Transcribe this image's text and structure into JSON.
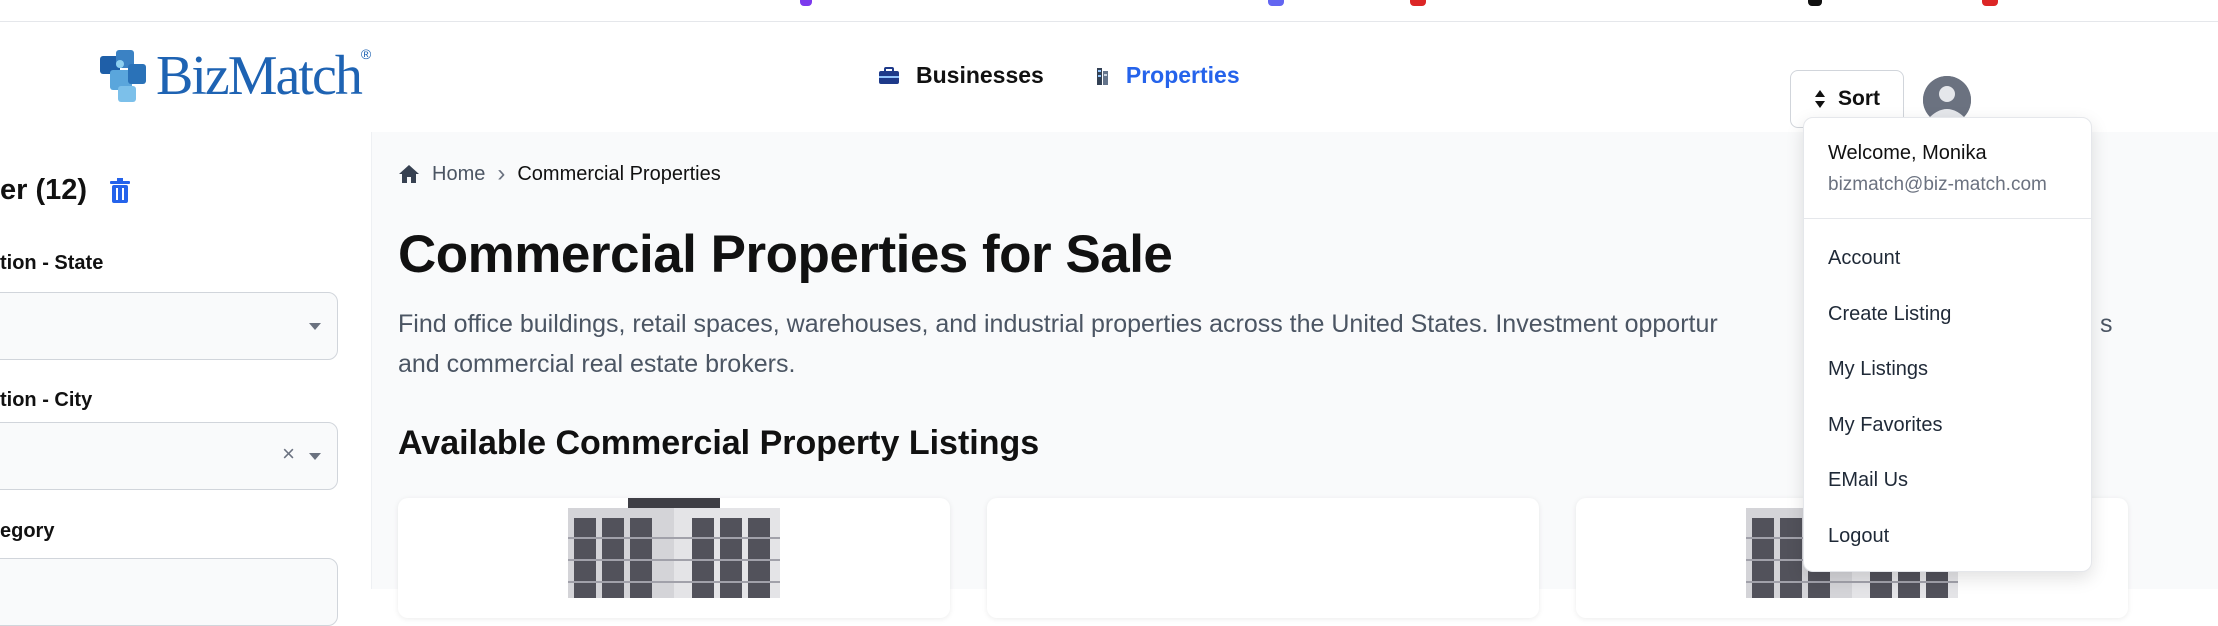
{
  "header": {
    "logo_text": "BizMatch",
    "logo_mark": "®",
    "nav": [
      {
        "label": "Businesses",
        "icon": "briefcase-icon",
        "active": false
      },
      {
        "label": "Properties",
        "icon": "building-icon",
        "active": true
      }
    ],
    "sort_label": "Sort"
  },
  "sidebar": {
    "title": "er (12)",
    "filters": [
      {
        "label": "tion - State",
        "value": ""
      },
      {
        "label": "tion - City",
        "value": "",
        "clear": "×"
      },
      {
        "label": "egory",
        "value": ""
      }
    ]
  },
  "main": {
    "breadcrumb": {
      "home": "Home",
      "separator": "›",
      "current": "Commercial Properties"
    },
    "title": "Commercial Properties for Sale",
    "intro_line1": "Find office buildings, retail spaces, warehouses, and industrial properties across the United States. Investment opportur",
    "intro_line1_tail": "s",
    "intro_line2": "and commercial real estate brokers.",
    "section_title": "Available Commercial Property Listings"
  },
  "user_menu": {
    "welcome": "Welcome, Monika",
    "email": "bizmatch@biz-match.com",
    "items": [
      "Account",
      "Create Listing",
      "My Listings",
      "My Favorites",
      "EMail Us",
      "Logout"
    ]
  },
  "colors": {
    "accent": "#2563eb",
    "logo": "#1e63b3",
    "text": "#111827",
    "muted": "#4b5563"
  }
}
